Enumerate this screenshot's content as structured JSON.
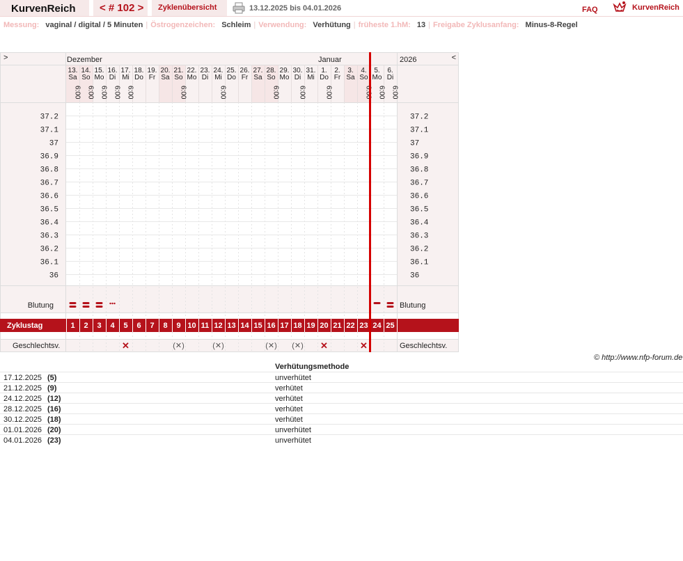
{
  "header": {
    "brand": "KurvenReich",
    "cycle_nav": "< # 102 >",
    "cycle_overview": "Zyklenübersicht",
    "date_range": "13.12.2025 bis 04.01.2026",
    "faq": "FAQ",
    "logo_text": "KurvenReich"
  },
  "info": {
    "messung_label": "Messung:",
    "messung_value": "vaginal / digital / 5 Minuten",
    "oestrogen_label": "Östrogenzeichen:",
    "oestrogen_value": "Schleim",
    "verwendung_label": "Verwendung:",
    "verwendung_value": "Verhütung",
    "hm_label": "früheste 1.hM:",
    "hm_value": "13",
    "freigabe_label": "Freigabe Zyklusanfang:",
    "freigabe_value": "Minus-8-Regel"
  },
  "colors": {
    "accent": "#b5121b",
    "weekend": "#f6e6e6",
    "light_pink": "#f8f1f1",
    "grid": "#e8e8e8"
  },
  "chart_data": {
    "type": "table",
    "nav_prev": ">",
    "nav_next": "<",
    "month_left": "Dezember",
    "month_mid": "Januar",
    "year": "2026",
    "days": [
      {
        "d": "13.",
        "wd": "Sa",
        "time": "6:00",
        "weekend": true
      },
      {
        "d": "14.",
        "wd": "So",
        "time": "6:00",
        "weekend": true
      },
      {
        "d": "15.",
        "wd": "Mo",
        "time": "6:00",
        "weekend": false
      },
      {
        "d": "16.",
        "wd": "Di",
        "time": "6:00",
        "weekend": false
      },
      {
        "d": "17.",
        "wd": "Mi",
        "time": "6:00",
        "weekend": false
      },
      {
        "d": "18.",
        "wd": "Do",
        "time": "",
        "weekend": false
      },
      {
        "d": "19.",
        "wd": "Fr",
        "time": "",
        "weekend": false
      },
      {
        "d": "20.",
        "wd": "Sa",
        "time": "",
        "weekend": true
      },
      {
        "d": "21.",
        "wd": "So",
        "time": "6:00",
        "weekend": true
      },
      {
        "d": "22.",
        "wd": "Mo",
        "time": "",
        "weekend": false
      },
      {
        "d": "23.",
        "wd": "Di",
        "time": "",
        "weekend": false
      },
      {
        "d": "24.",
        "wd": "Mi",
        "time": "6:00",
        "weekend": false
      },
      {
        "d": "25.",
        "wd": "Do",
        "time": "",
        "weekend": false
      },
      {
        "d": "26.",
        "wd": "Fr",
        "time": "",
        "weekend": false
      },
      {
        "d": "27.",
        "wd": "Sa",
        "time": "",
        "weekend": true
      },
      {
        "d": "28.",
        "wd": "So",
        "time": "6:00",
        "weekend": true
      },
      {
        "d": "29.",
        "wd": "Mo",
        "time": "",
        "weekend": false
      },
      {
        "d": "30.",
        "wd": "Di",
        "time": "6:00",
        "weekend": false
      },
      {
        "d": "31.",
        "wd": "Mi",
        "time": "",
        "weekend": false
      },
      {
        "d": "1.",
        "wd": "Do",
        "time": "6:00",
        "weekend": false
      },
      {
        "d": "2.",
        "wd": "Fr",
        "time": "",
        "weekend": false
      },
      {
        "d": "3.",
        "wd": "Sa",
        "time": "",
        "weekend": true
      },
      {
        "d": "4.",
        "wd": "So",
        "time": "6:00",
        "weekend": true
      },
      {
        "d": "5.",
        "wd": "Mo",
        "time": "6:00",
        "weekend": false
      },
      {
        "d": "6.",
        "wd": "Di",
        "time": "6:00",
        "weekend": false
      }
    ],
    "temp_ticks": [
      "37.2",
      "37.1",
      "37",
      "36.9",
      "36.8",
      "36.7",
      "36.6",
      "36.5",
      "36.4",
      "36.3",
      "36.2",
      "36.1",
      "36"
    ],
    "ylim": [
      36.0,
      37.2
    ],
    "temperatures": [],
    "row_blutung": "Blutung",
    "row_zyklustag": "Zyklustag",
    "row_geschlechtsv": "Geschlechtsv.",
    "bleeding": [
      "stark",
      "stark",
      "stark",
      "schmier",
      "",
      "",
      "",
      "",
      "",
      "",
      "",
      "",
      "",
      "",
      "",
      "",
      "",
      "",
      "",
      "",
      "",
      "",
      "",
      "mittel",
      "stark"
    ],
    "zyklustage": [
      "1",
      "2",
      "3",
      "4",
      "5",
      "6",
      "7",
      "8",
      "9",
      "10",
      "11",
      "12",
      "13",
      "14",
      "15",
      "16",
      "17",
      "18",
      "19",
      "20",
      "21",
      "22",
      "23",
      "24",
      "25"
    ],
    "intercourse": [
      "",
      "",
      "",
      "",
      "x",
      "",
      "",
      "",
      "(x)",
      "",
      "",
      "(x)",
      "",
      "",
      "",
      "(x)",
      "",
      "(x)",
      "",
      "x",
      "",
      "",
      "x",
      "",
      ""
    ],
    "new_cycle_index": 23
  },
  "copyright": "© http://www.nfp-forum.de",
  "verhuetung": {
    "header": "Verhütungsmethode",
    "rows": [
      {
        "date": "17.12.2025",
        "day": "(5)",
        "method": "unverhütet"
      },
      {
        "date": "21.12.2025",
        "day": "(9)",
        "method": "verhütet"
      },
      {
        "date": "24.12.2025",
        "day": "(12)",
        "method": "verhütet"
      },
      {
        "date": "28.12.2025",
        "day": "(16)",
        "method": "verhütet"
      },
      {
        "date": "30.12.2025",
        "day": "(18)",
        "method": "verhütet"
      },
      {
        "date": "01.01.2026",
        "day": "(20)",
        "method": "unverhütet"
      },
      {
        "date": "04.01.2026",
        "day": "(23)",
        "method": "unverhütet"
      }
    ]
  }
}
